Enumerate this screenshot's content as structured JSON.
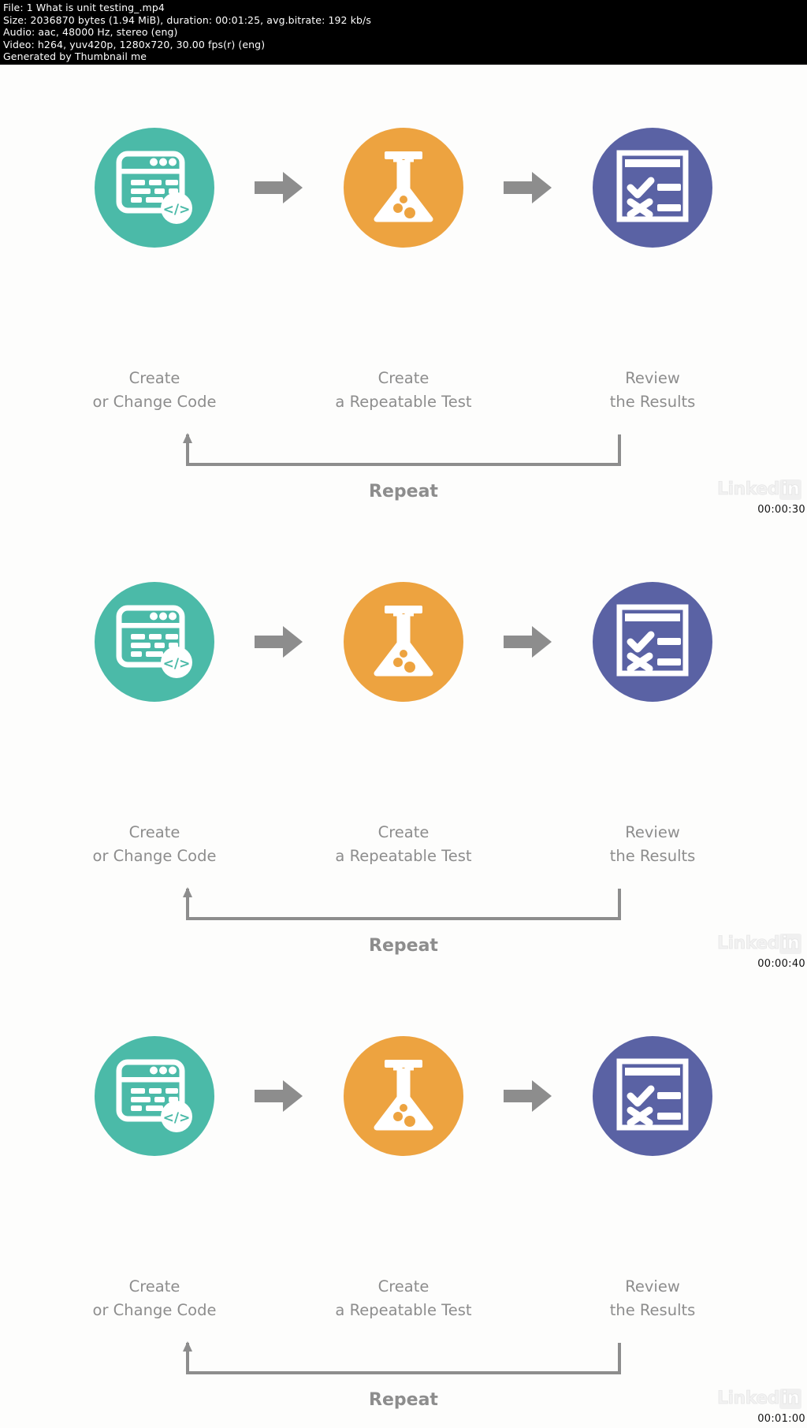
{
  "file_info": {
    "file_line": "File: 1 What is unit testing_.mp4",
    "size_line": "Size: 2036870 bytes (1.94 MiB), duration: 00:01:25, avg.bitrate: 192 kb/s",
    "audio_line": "Audio: aac, 48000 Hz, stereo (eng)",
    "video_line": "Video: h264, yuv420p, 1280x720, 30.00 fps(r) (eng)",
    "generated_line": "Generated by Thumbnail me"
  },
  "diagram": {
    "nodes": [
      {
        "icon": "code-window-icon",
        "color": "#4bbaa8",
        "line1": "Create",
        "line2": "or Change Code"
      },
      {
        "icon": "flask-icon",
        "color": "#eda340",
        "line1": "Create",
        "line2": "a Repeatable Test"
      },
      {
        "icon": "checklist-icon",
        "color": "#5a62a4",
        "line1": "Review",
        "line2": "the Results"
      }
    ],
    "arrow_icon": "arrow-right-icon",
    "loop_icon": "repeat-loop-arrow-icon",
    "repeat_label": "Repeat"
  },
  "watermark": {
    "brand_main": "Linked",
    "brand_badge": "in"
  },
  "thumbnails": [
    {
      "timestamp": "00:00:30"
    },
    {
      "timestamp": "00:00:40"
    },
    {
      "timestamp": "00:01:00"
    }
  ]
}
